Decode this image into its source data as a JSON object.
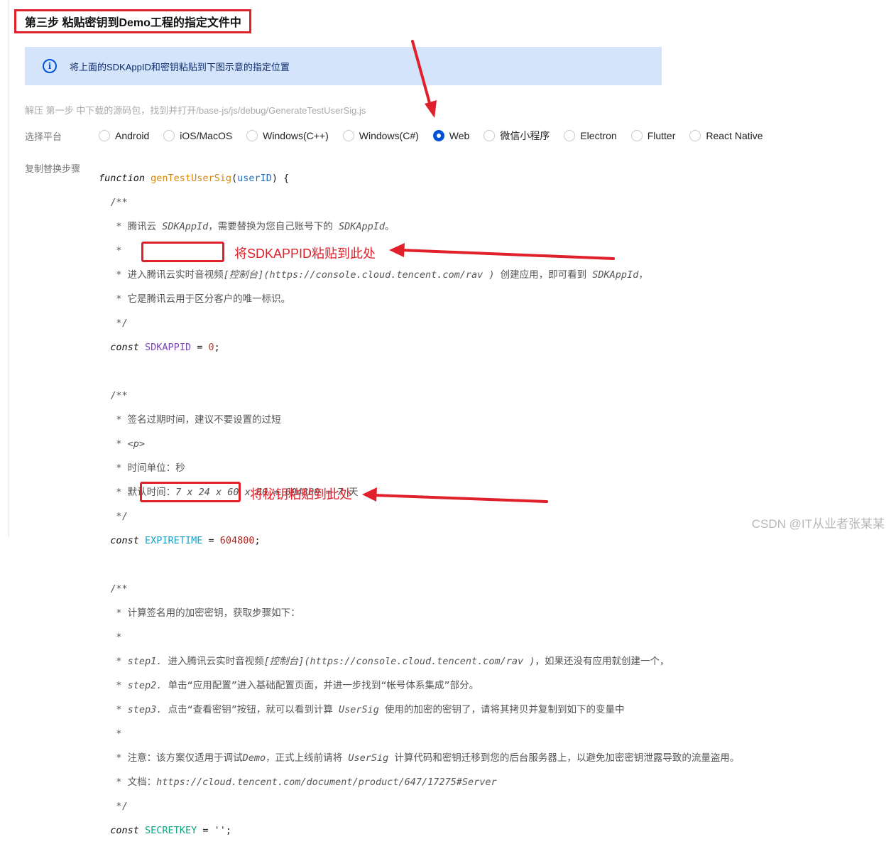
{
  "step_title": "第三步 粘贴密钥到Demo工程的指定文件中",
  "notice": {
    "icon": "info-icon",
    "text": "将上面的SDKAppID和密钥粘贴到下图示意的指定位置"
  },
  "hint": "解压 第一步 中下载的源码包，找到并打开/base-js/js/debug/GenerateTestUserSig.js",
  "platform": {
    "label": "选择平台",
    "selected": "Web",
    "options": [
      "Android",
      "iOS/MacOS",
      "Windows(C++)",
      "Windows(C#)",
      "Web",
      "微信小程序",
      "Electron",
      "Flutter",
      "React Native"
    ]
  },
  "copy_steps_label": "复制替换步骤",
  "code": {
    "l1_kw": "function",
    "l1_fn": "genTestUserSig",
    "l1_param": "userID",
    "c1": [
      "/**",
      " * 腾讯云 ",
      "SDKAppId",
      "，需要替换为您自己账号下的 ",
      "SDKAppId",
      "。"
    ],
    "c1_star": " *",
    "c1_l3a": " * 进入腾讯云实时音视频",
    "c1_l3b": "[控制台](https://console.cloud.tencent.com/rav )",
    "c1_l3c": " 创建应用，即可看到 ",
    "c1_l3d": "SDKAppId",
    "c1_l3e": "，",
    "c1_l4": " * 它是腾讯云用于区分客户的唯一标识。",
    "c1_end": " */",
    "const_kw": "const",
    "sdkappid_name": "SDKAPPID",
    "sdkappid_eq": " = ",
    "sdkappid_val": "0",
    "semi": ";",
    "c2_start": "/**",
    "c2_l1": " * 签名过期时间，建议不要设置的过短",
    "c2_l2a": " * ",
    "c2_l2b": "<p>",
    "c2_l3": " * 时间单位：秒",
    "c2_l4a": " * 默认时间：",
    "c2_l4b": "7 x 24 x 60 x 60 = 604800 = 7",
    "c2_l4c": " 天",
    "expire_name": "EXPIRETIME",
    "expire_val": "604800",
    "c3_l1": " * 计算签名用的加密密钥，获取步骤如下：",
    "c3_s1a": " * ",
    "c3_s1b": "step1.",
    "c3_s1c": " 进入腾讯云实时音视频",
    "c3_s1d": "[控制台](https://console.cloud.tencent.com/rav )",
    "c3_s1e": "，如果还没有应用就创建一个，",
    "c3_s2b": "step2.",
    "c3_s2c": " 单击“应用配置”进入基础配置页面，并进一步找到“帐号体系集成”部分。",
    "c3_s3b": "step3.",
    "c3_s3c": " 点击“查看密钥”按钮，就可以看到计算 ",
    "c3_s3d": "UserSig",
    "c3_s3e": " 使用的加密的密钥了，请将其拷贝并复制到如下的变量中",
    "c3_n1a": " * 注意：该方案仅适用于调试",
    "c3_n1b": "Demo",
    "c3_n1c": "，正式上线前请将 ",
    "c3_n1d": "UserSig",
    "c3_n1e": " 计算代码和密钥迁移到您的后台服务器上，以避免加密密钥泄露导致的流量盗用。",
    "c3_d1a": " * 文档：",
    "c3_d1b": "https://cloud.tencent.com/document/product/647/17275#Server",
    "secretkey_name": "SECRETKEY",
    "secretkey_val": "''"
  },
  "annotations": {
    "sdkappid": "将SDKAPPID粘贴到此处",
    "secretkey": "将秘钥粘贴到此处"
  },
  "watermark": "CSDN @IT从业者张某某",
  "colors": {
    "highlight": "#e0202a",
    "accent": "#0052d9",
    "notice_bg": "#d4e5fb"
  }
}
